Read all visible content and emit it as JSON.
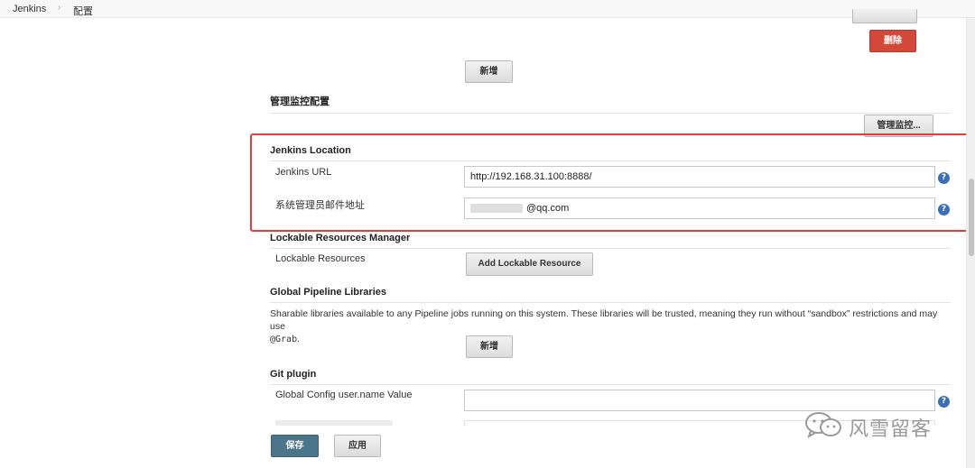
{
  "breadcrumb": {
    "items": [
      "Jenkins",
      "配置"
    ],
    "separator": "›"
  },
  "buttons": {
    "delete": "删除",
    "add_top": "新增",
    "manage_monitor": "管理监控...",
    "add_lockable": "Add Lockable Resource",
    "add_libraries": "新增",
    "save": "保存",
    "apply": "应用"
  },
  "monitor": {
    "title": "管理监控配置"
  },
  "jenkins_location": {
    "title": "Jenkins Location",
    "url_label": "Jenkins URL",
    "url_value": "http://192.168.31.100:8888/",
    "email_label": "系统管理员邮件地址",
    "email_value": "@qq.com"
  },
  "lockable": {
    "title": "Lockable Resources Manager",
    "label": "Lockable Resources"
  },
  "libraries": {
    "title": "Global Pipeline Libraries",
    "description": "Sharable libraries available to any Pipeline jobs running on this system. These libraries will be trusted, meaning they run without “sandbox” restrictions and may use",
    "code": "@Grab",
    "code_suffix": "."
  },
  "git": {
    "title": "Git plugin",
    "username_label": "Global Config user.name Value",
    "username_value": ""
  },
  "help": {
    "glyph": "?"
  },
  "watermark": {
    "text": "风雪留客",
    "icon": "wechat-icon"
  },
  "colors": {
    "highlight": "#e83b3b",
    "delete": "#d24939",
    "save": "#4b758b",
    "help": "#3d6fb4"
  }
}
